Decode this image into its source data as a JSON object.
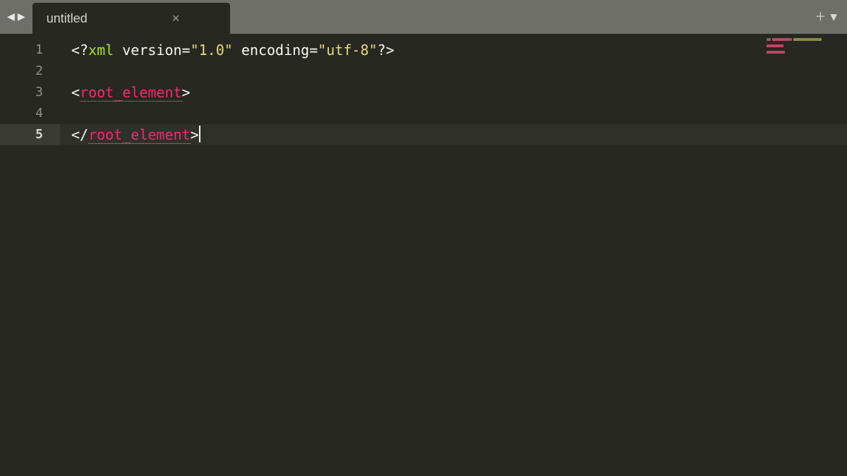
{
  "tab": {
    "title": "untitled"
  },
  "gutter": {
    "numbers": [
      "1",
      "2",
      "3",
      "4",
      "5"
    ],
    "current": 5
  },
  "code": {
    "line1": {
      "open": "<?",
      "xml": "xml",
      "sp1": " ",
      "attr1": "version=",
      "val1": "\"1.0\"",
      "sp2": " ",
      "attr2": "encoding=",
      "val2": "\"utf-8\"",
      "close": "?>"
    },
    "line3": {
      "open": "<",
      "tag": "root_element",
      "close": ">"
    },
    "line5": {
      "open": "</",
      "tag": "root_element",
      "close": ">"
    }
  }
}
